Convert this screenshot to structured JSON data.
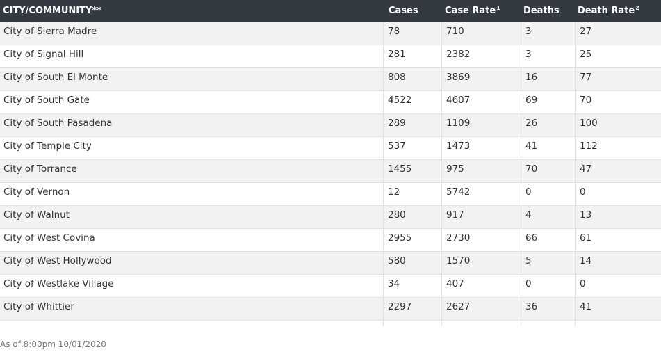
{
  "table": {
    "headers": {
      "city": "CITY/COMMUNITY**",
      "cases": "Cases",
      "case_rate": "Case Rate",
      "case_rate_note": "1",
      "deaths": "Deaths",
      "death_rate": "Death Rate",
      "death_rate_note": "2"
    },
    "rows": [
      {
        "city": "City of Sierra Madre",
        "cases": "78",
        "case_rate": "710",
        "deaths": "3",
        "death_rate": "27"
      },
      {
        "city": "City of Signal Hill",
        "cases": "281",
        "case_rate": "2382",
        "deaths": "3",
        "death_rate": "25"
      },
      {
        "city": "City of South El Monte",
        "cases": "808",
        "case_rate": "3869",
        "deaths": "16",
        "death_rate": "77"
      },
      {
        "city": "City of South Gate",
        "cases": "4522",
        "case_rate": "4607",
        "deaths": "69",
        "death_rate": "70"
      },
      {
        "city": "City of South Pasadena",
        "cases": "289",
        "case_rate": "1109",
        "deaths": "26",
        "death_rate": "100"
      },
      {
        "city": "City of Temple City",
        "cases": "537",
        "case_rate": "1473",
        "deaths": "41",
        "death_rate": "112"
      },
      {
        "city": "City of Torrance",
        "cases": "1455",
        "case_rate": "975",
        "deaths": "70",
        "death_rate": "47"
      },
      {
        "city": "City of Vernon",
        "cases": "12",
        "case_rate": "5742",
        "deaths": "0",
        "death_rate": "0"
      },
      {
        "city": "City of Walnut",
        "cases": "280",
        "case_rate": "917",
        "deaths": "4",
        "death_rate": "13"
      },
      {
        "city": "City of West Covina",
        "cases": "2955",
        "case_rate": "2730",
        "deaths": "66",
        "death_rate": "61"
      },
      {
        "city": "City of West Hollywood",
        "cases": "580",
        "case_rate": "1570",
        "deaths": "5",
        "death_rate": "14"
      },
      {
        "city": "City of Westlake Village",
        "cases": "34",
        "case_rate": "407",
        "deaths": "0",
        "death_rate": "0"
      },
      {
        "city": "City of Whittier",
        "cases": "2297",
        "case_rate": "2627",
        "deaths": "36",
        "death_rate": "41"
      }
    ]
  },
  "footnote": "As of 8:00pm 10/01/2020",
  "colors": {
    "header_bg": "#343a40",
    "header_text": "#ffffff",
    "row_stripe": "#f2f2f2",
    "row_border": "#dee2e6",
    "footnote_text": "#777777"
  }
}
